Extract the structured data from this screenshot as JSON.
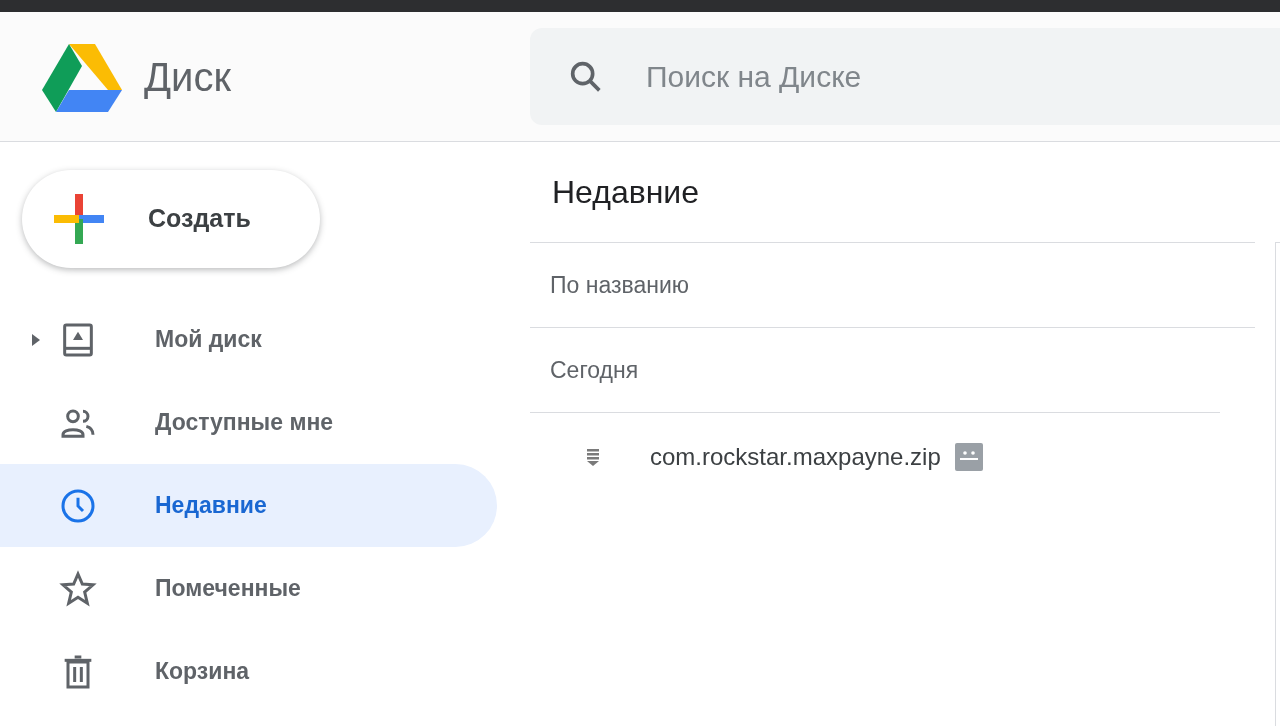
{
  "header": {
    "app_name": "Диск",
    "search": {
      "placeholder": "Поиск на Диске"
    }
  },
  "sidebar": {
    "create_button": "Создать",
    "items": [
      {
        "kind": "drive",
        "label": "Мой диск",
        "selected": false,
        "expanded": false
      },
      {
        "kind": "shared",
        "label": "Доступные мне",
        "selected": false
      },
      {
        "kind": "recent",
        "label": "Недавние",
        "selected": true
      },
      {
        "kind": "starred",
        "label": "Помеченные",
        "selected": false
      },
      {
        "kind": "trash",
        "label": "Корзина",
        "selected": false
      }
    ]
  },
  "main": {
    "title": "Недавние",
    "sort_label": "По названию",
    "groups": [
      {
        "label": "Сегодня",
        "files": [
          {
            "name": "com.rockstar.maxpayne.zip"
          }
        ]
      }
    ]
  }
}
